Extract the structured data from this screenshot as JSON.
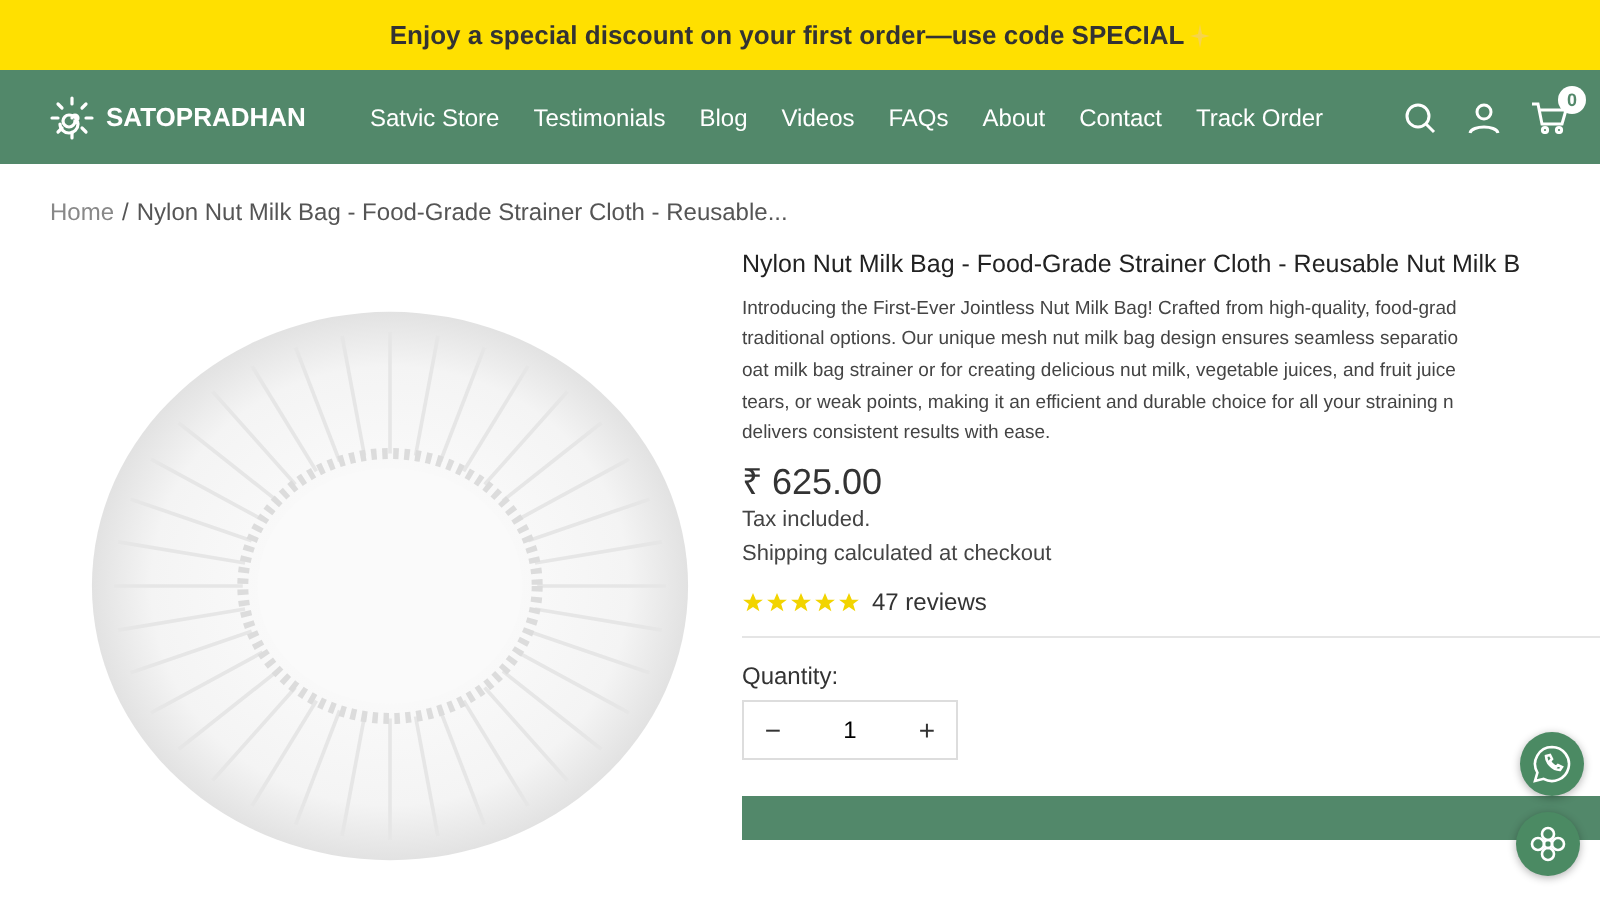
{
  "announcement": "Enjoy a special discount on your first order—use code SPECIAL",
  "header": {
    "logo": "SATOPRADHAN",
    "nav": [
      "Satvic Store",
      "Testimonials",
      "Blog",
      "Videos",
      "FAQs",
      "About",
      "Contact",
      "Track Order"
    ],
    "cart_count": "0"
  },
  "breadcrumb": {
    "home": "Home",
    "separator": "/",
    "current": "Nylon Nut Milk Bag - Food-Grade Strainer Cloth - Reusable..."
  },
  "product": {
    "title": "Nylon Nut Milk Bag - Food-Grade Strainer Cloth - Reusable Nut Milk B",
    "description": [
      "Introducing the First-Ever Jointless Nut Milk Bag! Crafted from high-quality, food-grad",
      "traditional options. Our unique mesh nut milk bag design ensures seamless separatio",
      "oat milk bag strainer or for creating delicious nut milk, vegetable juices, and fruit juice",
      "tears, or weak points, making it an efficient and durable choice for all your straining n",
      "delivers consistent results with ease."
    ],
    "price": "₹ 625.00",
    "tax_note": "Tax included.",
    "shipping_note": "Shipping calculated at checkout",
    "stars": 5,
    "reviews": "47 reviews",
    "quantity_label": "Quantity:",
    "quantity": "1",
    "decrease": "−",
    "increase": "+"
  }
}
